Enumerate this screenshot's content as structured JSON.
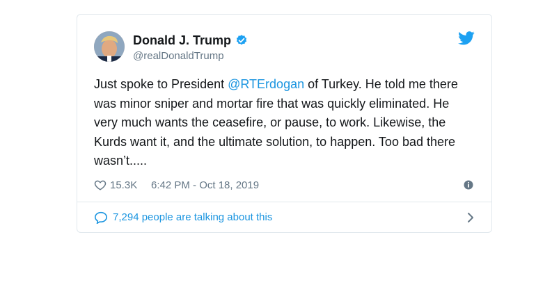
{
  "tweet": {
    "display_name": "Donald J. Trump",
    "handle": "@realDonaldTrump",
    "text_parts": {
      "before_mention": "Just spoke to President ",
      "mention": "@RTErdogan",
      "after_mention": " of Turkey. He told me there was minor sniper and mortar fire that was quickly eliminated. He very much wants the ceasefire, or pause, to work. Likewise, the Kurds want it, and the ultimate solution, to happen. Too bad there wasn’t....."
    },
    "likes": "15.3K",
    "timestamp": "6:42 PM - Oct 18, 2019",
    "talking_label": "7,294 people are talking about this"
  },
  "icons": {
    "avatar": "profile-photo",
    "verified": "verified-badge-icon",
    "bird": "twitter-bird-icon",
    "like": "heart-icon",
    "info": "info-icon",
    "reply": "speech-bubble-icon",
    "chevron": "chevron-right-icon"
  },
  "colors": {
    "accent": "#1b95e0",
    "text": "#14171a",
    "muted": "#657786",
    "border": "#e1e8ed"
  }
}
